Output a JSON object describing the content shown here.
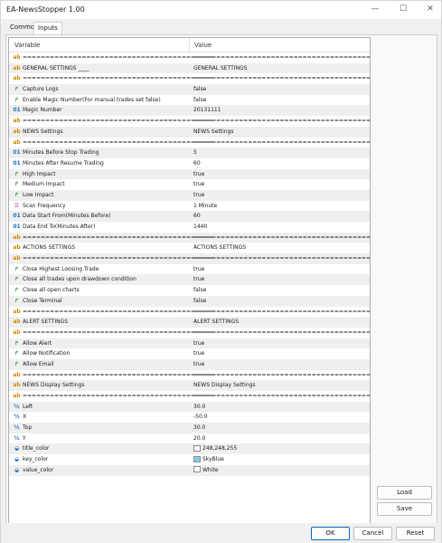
{
  "window": {
    "title": "EA-NewsStopper 1.00",
    "min_glyph": "—",
    "max_glyph": "☐",
    "close_glyph": "✕"
  },
  "tabs": [
    {
      "label": "Common"
    },
    {
      "label": "Inputs"
    }
  ],
  "grid": {
    "col_variable": "Variable",
    "col_value": "Value",
    "rows": [
      {
        "icon": "abc",
        "glyph": "ab",
        "name": "==========================================",
        "value": "=========================================="
      },
      {
        "icon": "abc",
        "glyph": "ab",
        "name": "GENERAL SETTINGS ____",
        "value": "GENERAL SETTINGS"
      },
      {
        "icon": "abc",
        "glyph": "ab",
        "name": "==========================================",
        "value": "=========================================="
      },
      {
        "icon": "bool",
        "glyph": "↱",
        "name": "Capture Logs",
        "value": "false"
      },
      {
        "icon": "bool",
        "glyph": "↱",
        "name": "Enable Magic Number(For manual trades set false)",
        "value": "false"
      },
      {
        "icon": "int",
        "glyph": "01",
        "name": "Magic Number",
        "value": "20131111"
      },
      {
        "icon": "abc",
        "glyph": "ab",
        "name": "==========================================",
        "value": "=========================================="
      },
      {
        "icon": "abc",
        "glyph": "ab",
        "name": "NEWS Settings",
        "value": "NEWS Settings"
      },
      {
        "icon": "abc",
        "glyph": "ab",
        "name": "==========================================",
        "value": "=========================================="
      },
      {
        "icon": "int",
        "glyph": "01",
        "name": "Minutes Before Stop Trading",
        "value": "5"
      },
      {
        "icon": "int",
        "glyph": "01",
        "name": "Minutes After Resume Trading",
        "value": "60"
      },
      {
        "icon": "bool",
        "glyph": "↱",
        "name": "High Impact",
        "value": "true"
      },
      {
        "icon": "bool",
        "glyph": "↱",
        "name": "Medium Impact",
        "value": "true"
      },
      {
        "icon": "bool",
        "glyph": "↱",
        "name": "Low Impact",
        "value": "true"
      },
      {
        "icon": "enum",
        "glyph": "☰",
        "name": "Scan Frequency",
        "value": "1 Minute"
      },
      {
        "icon": "int",
        "glyph": "01",
        "name": "Data Start From(Minutes Before)",
        "value": "60"
      },
      {
        "icon": "int",
        "glyph": "01",
        "name": "Data End To(Minutes After)",
        "value": "1440"
      },
      {
        "icon": "abc",
        "glyph": "ab",
        "name": "==========================================",
        "value": "=========================================="
      },
      {
        "icon": "abc",
        "glyph": "ab",
        "name": "ACTIONS SETTINGS",
        "value": "ACTIONS SETTINGS"
      },
      {
        "icon": "abc",
        "glyph": "ab",
        "name": "==========================================",
        "value": "=========================================="
      },
      {
        "icon": "bool",
        "glyph": "↱",
        "name": "Close Highest Loosing Trade",
        "value": "true"
      },
      {
        "icon": "bool",
        "glyph": "↱",
        "name": "Close all trades upon drawdown condition",
        "value": "true"
      },
      {
        "icon": "bool",
        "glyph": "↱",
        "name": "Close all open charts",
        "value": "false"
      },
      {
        "icon": "bool",
        "glyph": "↱",
        "name": "Close Terminal",
        "value": "false"
      },
      {
        "icon": "abc",
        "glyph": "ab",
        "name": "==========================================",
        "value": "=========================================="
      },
      {
        "icon": "abc",
        "glyph": "ab",
        "name": "ALERT SETTINGS",
        "value": "ALERT SETTINGS"
      },
      {
        "icon": "abc",
        "glyph": "ab",
        "name": "==========================================",
        "value": "=========================================="
      },
      {
        "icon": "bool",
        "glyph": "↱",
        "name": "Allow Alert",
        "value": "true"
      },
      {
        "icon": "bool",
        "glyph": "↱",
        "name": "Allow Notification",
        "value": "true"
      },
      {
        "icon": "bool",
        "glyph": "↱",
        "name": "Allow Email",
        "value": "true"
      },
      {
        "icon": "abc",
        "glyph": "ab",
        "name": "==========================================",
        "value": "=========================================="
      },
      {
        "icon": "abc",
        "glyph": "ab",
        "name": "NEWS Display Settings",
        "value": "NEWS Display Settings"
      },
      {
        "icon": "abc",
        "glyph": "ab",
        "name": "==========================================",
        "value": "=========================================="
      },
      {
        "icon": "dbl",
        "glyph": "½",
        "name": "Left",
        "value": "30.0"
      },
      {
        "icon": "dbl",
        "glyph": "½",
        "name": "X",
        "value": "-50.0"
      },
      {
        "icon": "dbl",
        "glyph": "½",
        "name": "Top",
        "value": "30.0"
      },
      {
        "icon": "dbl",
        "glyph": "½",
        "name": "Y",
        "value": "20.0"
      },
      {
        "icon": "clr",
        "glyph": "◒",
        "name": "title_color",
        "value": "248,248,255",
        "swatch": "#f8f8ff"
      },
      {
        "icon": "clr",
        "glyph": "◒",
        "name": "key_color",
        "value": "SkyBlue",
        "swatch": "#87ceeb"
      },
      {
        "icon": "clr",
        "glyph": "◒",
        "name": "value_color",
        "value": "White",
        "swatch": "#ffffff"
      }
    ]
  },
  "buttons": {
    "load": "Load",
    "save": "Save",
    "ok": "OK",
    "cancel": "Cancel",
    "reset": "Reset"
  }
}
